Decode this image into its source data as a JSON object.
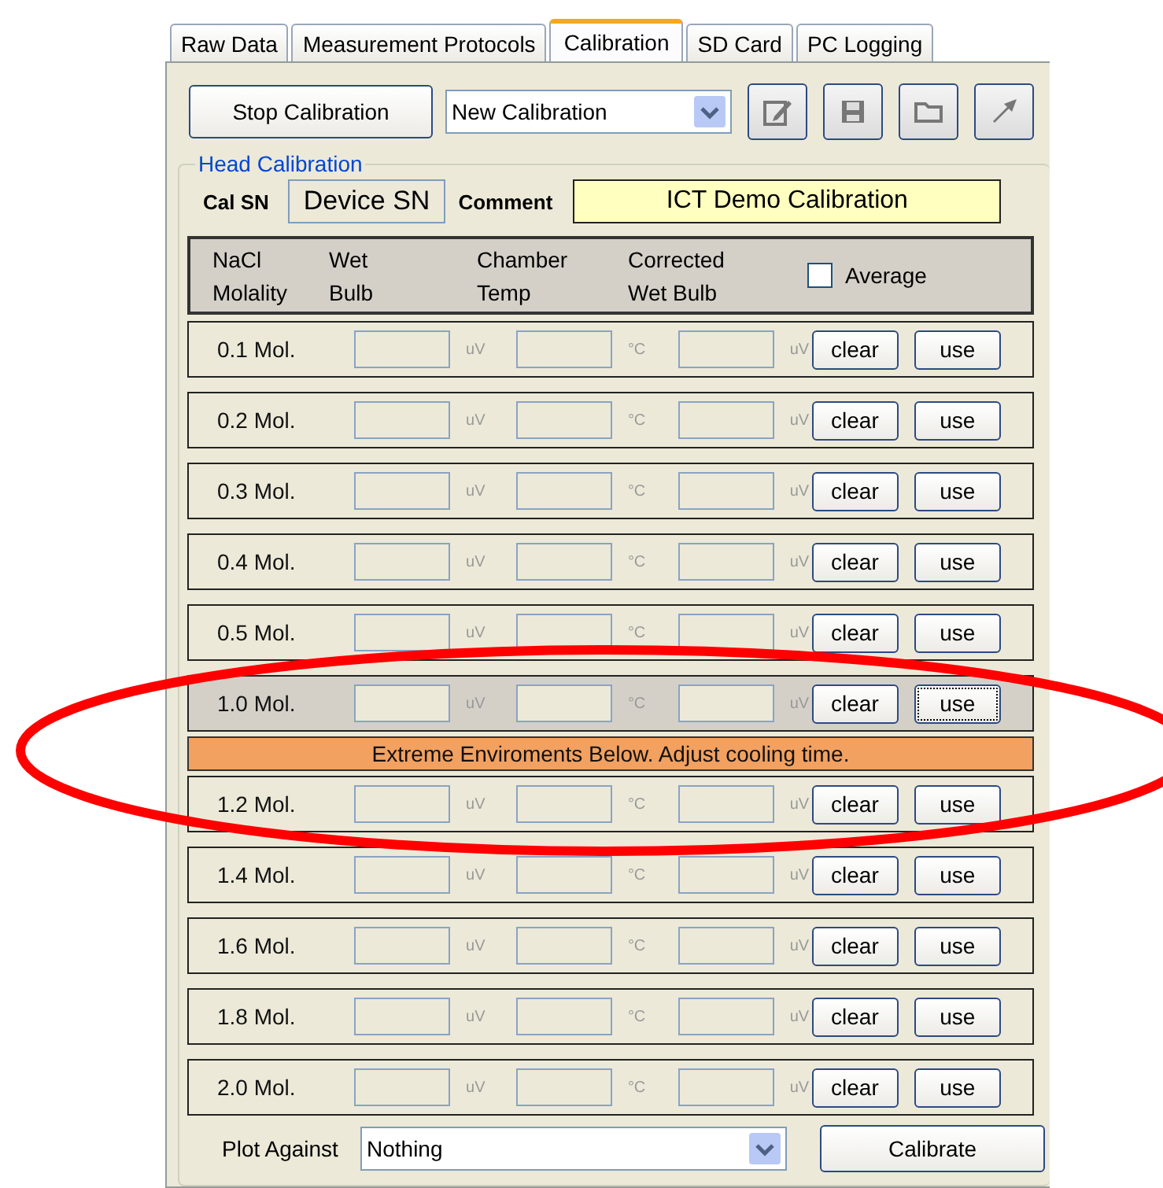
{
  "tabs": [
    {
      "label": "Raw Data",
      "selected": false
    },
    {
      "label": "Measurement Protocols",
      "selected": false
    },
    {
      "label": "Calibration",
      "selected": true
    },
    {
      "label": "SD Card",
      "selected": false
    },
    {
      "label": "PC Logging",
      "selected": false
    }
  ],
  "toolbar": {
    "stop_button": "Stop Calibration",
    "calibration_select": {
      "value": "New Calibration"
    },
    "icon_buttons": [
      {
        "kind": "edit"
      },
      {
        "kind": "save"
      },
      {
        "kind": "open"
      },
      {
        "kind": "export"
      }
    ]
  },
  "group": {
    "title": "Head Calibration",
    "cal_sn": {
      "label": "Cal SN",
      "value": "Device SN"
    },
    "comment": {
      "label": "Comment",
      "value": "ICT Demo Calibration"
    },
    "header": {
      "columns": [
        [
          "NaCl",
          "Molality"
        ],
        [
          "Wet",
          "Bulb"
        ],
        [
          "Chamber",
          "Temp"
        ],
        [
          "Corrected",
          "Wet Bulb"
        ]
      ],
      "average": {
        "label": "Average",
        "checked": false
      }
    },
    "rows": [
      {
        "kind": "row",
        "label": "0.1 Mol.",
        "units": [
          "uV",
          "°C",
          "uV"
        ],
        "clear": "clear",
        "use": "use",
        "selected": false
      },
      {
        "kind": "row",
        "label": "0.2 Mol.",
        "units": [
          "uV",
          "°C",
          "uV"
        ],
        "clear": "clear",
        "use": "use",
        "selected": false
      },
      {
        "kind": "row",
        "label": "0.3 Mol.",
        "units": [
          "uV",
          "°C",
          "uV"
        ],
        "clear": "clear",
        "use": "use",
        "selected": false
      },
      {
        "kind": "row",
        "label": "0.4 Mol.",
        "units": [
          "uV",
          "°C",
          "uV"
        ],
        "clear": "clear",
        "use": "use",
        "selected": false
      },
      {
        "kind": "row",
        "label": "0.5 Mol.",
        "units": [
          "uV",
          "°C",
          "uV"
        ],
        "clear": "clear",
        "use": "use",
        "selected": false
      },
      {
        "kind": "row",
        "label": "1.0 Mol.",
        "units": [
          "uV",
          "°C",
          "uV"
        ],
        "clear": "clear",
        "use": "use",
        "selected": true
      },
      {
        "kind": "notice",
        "text": "Extreme Enviroments Below. Adjust cooling time."
      },
      {
        "kind": "row",
        "label": "1.2 Mol.",
        "units": [
          "uV",
          "°C",
          "uV"
        ],
        "clear": "clear",
        "use": "use",
        "selected": false
      },
      {
        "kind": "row",
        "label": "1.4 Mol.",
        "units": [
          "uV",
          "°C",
          "uV"
        ],
        "clear": "clear",
        "use": "use",
        "selected": false
      },
      {
        "kind": "row",
        "label": "1.6 Mol.",
        "units": [
          "uV",
          "°C",
          "uV"
        ],
        "clear": "clear",
        "use": "use",
        "selected": false
      },
      {
        "kind": "row",
        "label": "1.8 Mol.",
        "units": [
          "uV",
          "°C",
          "uV"
        ],
        "clear": "clear",
        "use": "use",
        "selected": false
      },
      {
        "kind": "row",
        "label": "2.0 Mol.",
        "units": [
          "uV",
          "°C",
          "uV"
        ],
        "clear": "clear",
        "use": "use",
        "selected": false
      }
    ],
    "plot_against": {
      "label": "Plot Against",
      "value": "Nothing"
    },
    "calibrate_button": "Calibrate"
  },
  "annotation": {
    "kind": "ellipse"
  }
}
